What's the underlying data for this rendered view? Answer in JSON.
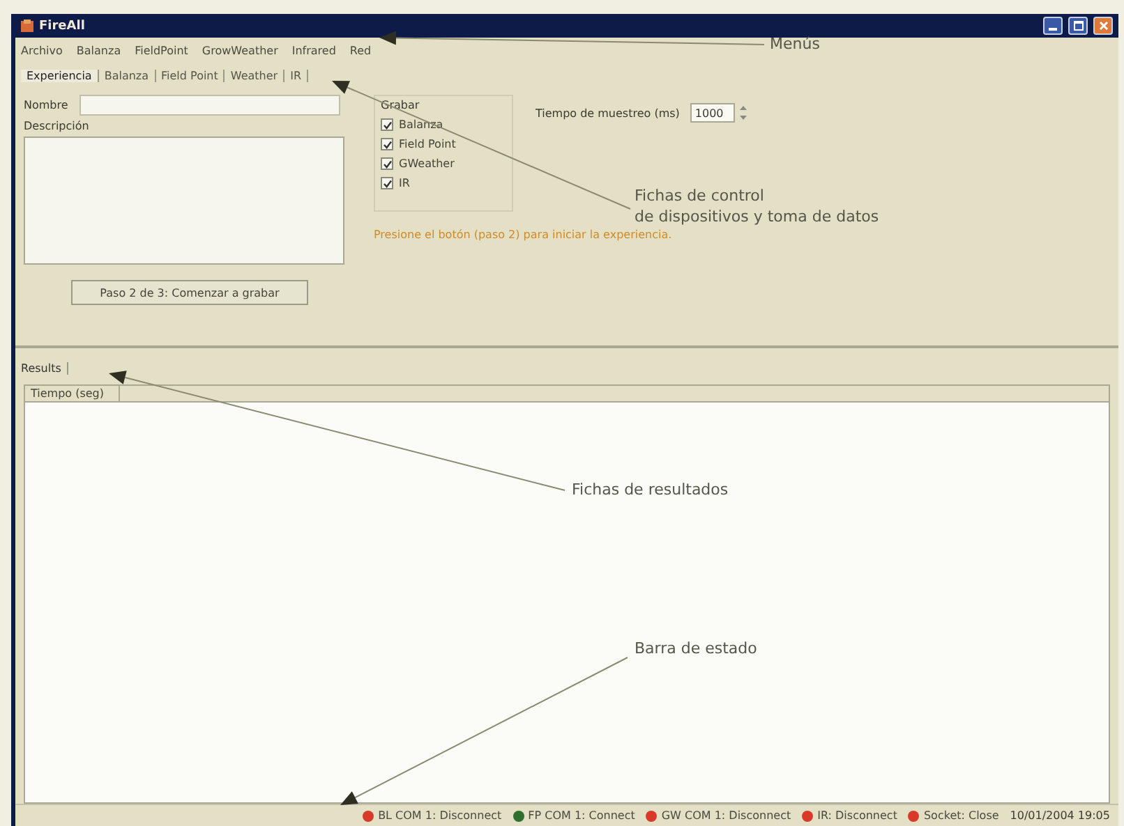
{
  "window": {
    "title": "FireAll"
  },
  "menu": [
    "Archivo",
    "Balanza",
    "FieldPoint",
    "GrowWeather",
    "Infrared",
    "Red"
  ],
  "tabs": [
    {
      "label": "Experiencia",
      "selected": true
    },
    {
      "label": "Balanza",
      "selected": false
    },
    {
      "label": "Field Point",
      "selected": false
    },
    {
      "label": "Weather",
      "selected": false
    },
    {
      "label": "IR",
      "selected": false
    }
  ],
  "form": {
    "name_label": "Nombre",
    "description_label": "Descripción",
    "start_button": "Paso 2 de 3: Comenzar a grabar",
    "record_group": {
      "title": "Grabar",
      "options": [
        {
          "label": "Balanza",
          "checked": true
        },
        {
          "label": "Field Point",
          "checked": true
        },
        {
          "label": "GWeather",
          "checked": true
        },
        {
          "label": "IR",
          "checked": true
        }
      ]
    },
    "sample_time_label": "Tiempo de muestreo (ms)",
    "sample_time_value": "1000",
    "hint": "Presione el botón (paso 2) para iniciar la experiencia."
  },
  "results_tabs": [
    {
      "label": "Results",
      "selected": true
    }
  ],
  "table": {
    "columns": [
      "Tiempo (seg)"
    ]
  },
  "status_bar": [
    {
      "text": "BL COM 1: Disconnect",
      "color": "#d83a2a"
    },
    {
      "text": "FP COM 1: Connect",
      "color": "#2f6e2f"
    },
    {
      "text": "GW COM 1: Disconnect",
      "color": "#d83a2a"
    },
    {
      "text": "IR: Disconnect",
      "color": "#d83a2a"
    },
    {
      "text": "Socket: Close",
      "color": "#d83a2a"
    }
  ],
  "status_time": "10/01/2004 19:05",
  "annotations": [
    "Menús",
    "Fichas de control\nde dispositivos y toma de datos",
    "Fichas de resultados",
    "Barra de estado"
  ]
}
